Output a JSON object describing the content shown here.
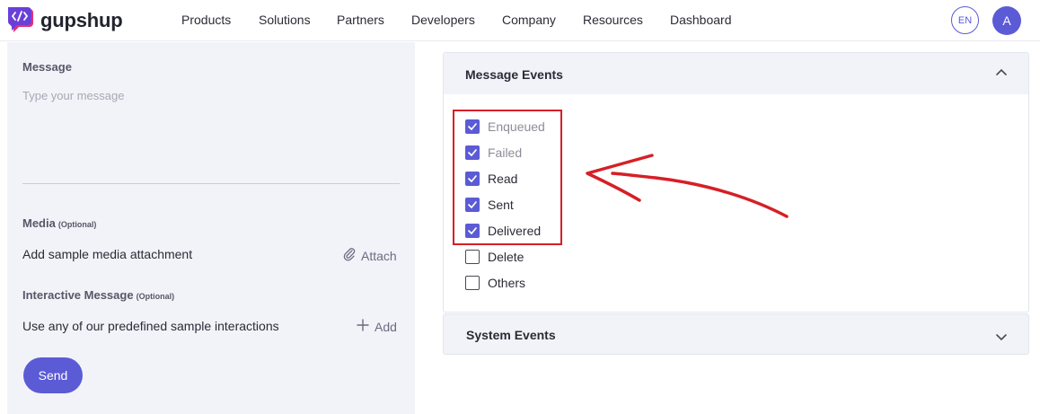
{
  "header": {
    "brand": "gupshup",
    "nav": [
      "Products",
      "Solutions",
      "Partners",
      "Developers",
      "Company",
      "Resources",
      "Dashboard"
    ],
    "language": "EN",
    "avatar_initial": "A"
  },
  "left_panel": {
    "message_label": "Message",
    "message_placeholder": "Type your message",
    "media_label": "Media",
    "media_optional": "(Optional)",
    "media_text": "Add sample media attachment",
    "attach_label": "Attach",
    "interactive_label": "Interactive Message",
    "interactive_optional": "(Optional)",
    "interactive_text": "Use any of our predefined sample interactions",
    "add_label": "Add",
    "send_label": "Send"
  },
  "message_events": {
    "title": "Message Events",
    "options": [
      {
        "label": "Enqueued",
        "checked": true,
        "muted": true
      },
      {
        "label": "Failed",
        "checked": true,
        "muted": true
      },
      {
        "label": "Read",
        "checked": true,
        "muted": false
      },
      {
        "label": "Sent",
        "checked": true,
        "muted": false
      },
      {
        "label": "Delivered",
        "checked": true,
        "muted": false
      },
      {
        "label": "Delete",
        "checked": false,
        "muted": false
      },
      {
        "label": "Others",
        "checked": false,
        "muted": false
      }
    ]
  },
  "system_events": {
    "title": "System Events"
  },
  "colors": {
    "accent": "#5b5bd6",
    "highlight": "#d61f26",
    "panel_bg": "#f1f3f9"
  }
}
